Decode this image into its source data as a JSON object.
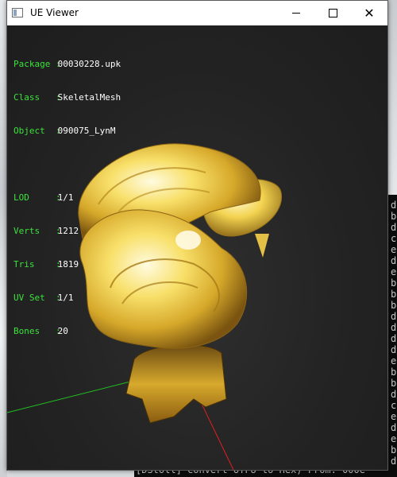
{
  "window": {
    "title": "UE Viewer"
  },
  "titlebar_buttons": {
    "minimize": "minimize",
    "maximize": "maximize",
    "close": "close"
  },
  "info": {
    "package_label": "Package :",
    "package_value": "00030228.upk",
    "class_label": "Class   :",
    "class_value": "SkeletalMesh",
    "object_label": "Object  :",
    "object_value": "090075_LynM",
    "lod_label": "LOD     :",
    "lod_value": "1/1",
    "verts_label": "Verts   :",
    "verts_value": "1212",
    "tris_label": "Tris    :",
    "tris_value": "1819",
    "uvset_label": "UV Set  :",
    "uvset_value": "1/1",
    "bones_label": "Bones   :",
    "bones_value": "20"
  },
  "console": {
    "bottom_line": "[DStoll] Convert UTF8 to Hex) From: 000e"
  },
  "colors": {
    "label_green": "#3be33b",
    "value_white": "#ffffff",
    "viewport_bg": "#232323",
    "axis_x": "#e02020",
    "axis_y": "#20c020",
    "axis_z": "#3030e0",
    "mesh_gold": "#f5d84a"
  }
}
